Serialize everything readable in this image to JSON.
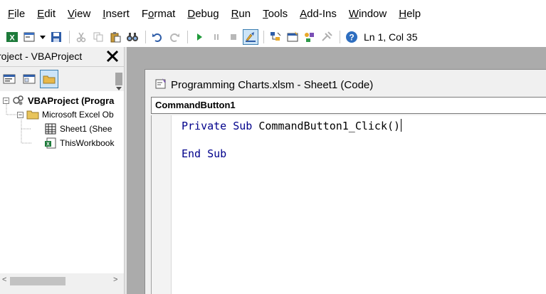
{
  "menu": {
    "items": [
      {
        "u": "F",
        "rest": "ile"
      },
      {
        "u": "E",
        "rest": "dit"
      },
      {
        "u": "V",
        "rest": "iew"
      },
      {
        "u": "I",
        "rest": "nsert"
      },
      {
        "pre": "F",
        "u": "o",
        "rest": "rmat"
      },
      {
        "u": "D",
        "rest": "ebug"
      },
      {
        "u": "R",
        "rest": "un"
      },
      {
        "u": "T",
        "rest": "ools"
      },
      {
        "u": "A",
        "rest": "dd-Ins"
      },
      {
        "u": "W",
        "rest": "indow"
      },
      {
        "u": "H",
        "rest": "elp"
      }
    ]
  },
  "toolbar": {
    "status": "Ln 1, Col 35"
  },
  "project": {
    "title": "roject - VBAProject",
    "close_glyph": "✕",
    "tree": {
      "root": "VBAProject (Progra",
      "folder": "Microsoft Excel Ob",
      "sheet": "Sheet1 (Shee",
      "workbook": "ThisWorkbook"
    }
  },
  "code_window": {
    "title": "Programming Charts.xlsm - Sheet1 (Code)",
    "object_combo": "CommandButton1",
    "line1": {
      "kw1": "Private",
      "kw2": "Sub",
      "rest": "CommandButton1_Click()"
    },
    "line2": {
      "kw1": "End",
      "kw2": "Sub"
    }
  },
  "colors": {
    "keyword": "#00008b",
    "accent": "#3c7fb1"
  }
}
